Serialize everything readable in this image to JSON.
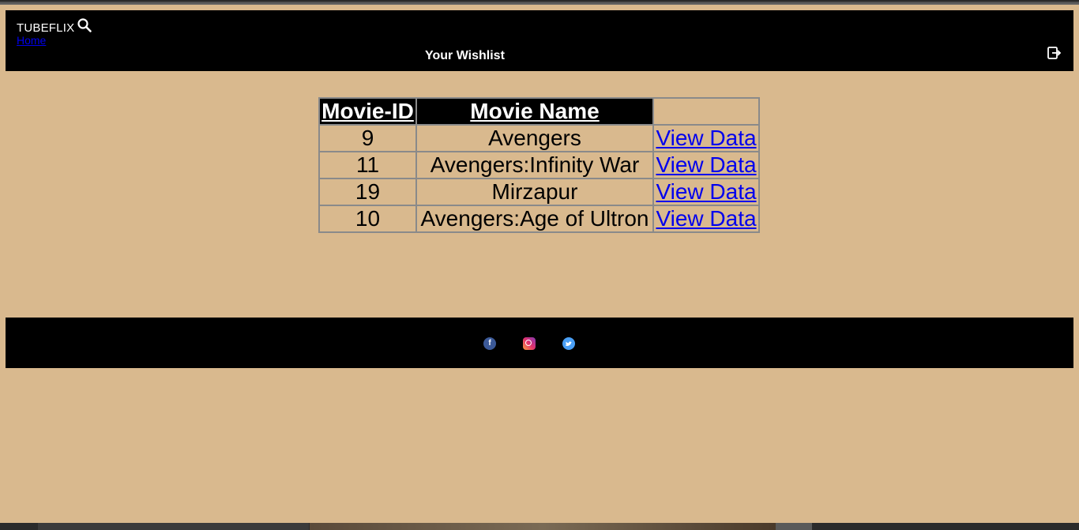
{
  "header": {
    "brand": "TUBEFLIX",
    "home_link": "Home",
    "title": "Your Wishlist",
    "icons": {
      "search": "search-icon",
      "logout": "logout-icon"
    }
  },
  "table": {
    "headers": [
      "Movie-ID",
      "Movie Name",
      ""
    ],
    "rows": [
      {
        "id": "9",
        "name": "Avengers",
        "action": "View Data"
      },
      {
        "id": "11",
        "name": "Avengers:Infinity War",
        "action": "View Data"
      },
      {
        "id": "19",
        "name": "Mirzapur",
        "action": "View Data"
      },
      {
        "id": "10",
        "name": "Avengers:Age of Ultron",
        "action": "View Data"
      }
    ]
  },
  "footer": {
    "social": [
      {
        "name": "facebook",
        "glyph": "f",
        "color": "#3b5998"
      },
      {
        "name": "instagram",
        "color": "#e1306c"
      },
      {
        "name": "twitter",
        "color": "#4a9ff5"
      }
    ]
  },
  "colors": {
    "background": "#d9b98e",
    "bar": "#000000",
    "link": "#0000ee"
  }
}
